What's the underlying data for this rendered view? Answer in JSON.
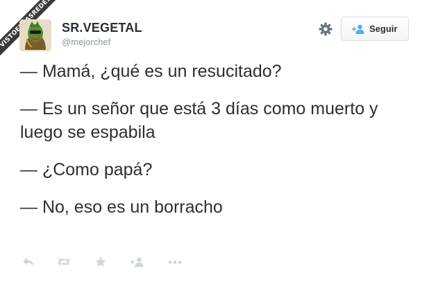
{
  "watermark": "VISTOENLASREDES",
  "author": {
    "name": "SR.VEGETAL",
    "handle": "@mejorchef"
  },
  "header": {
    "settings_icon": "gear-icon",
    "follow_label": "Seguir",
    "follow_icon": "add-person-icon"
  },
  "tweet": {
    "lines": [
      "— Mamá, ¿qué es un resucitado?",
      "— Es un señor que está 3 días como muerto y luego se espabila",
      "— ¿Como papá?",
      "— No, eso es un borracho"
    ]
  },
  "actions": [
    "reply-icon",
    "retweet-icon",
    "favorite-icon",
    "follow-icon",
    "more-icon"
  ],
  "colors": {
    "text": "#292f33",
    "muted": "#8899a6",
    "icon": "#ccd6dd",
    "follow_icon": "#55acee",
    "ribbon": "#3a3a3a"
  }
}
